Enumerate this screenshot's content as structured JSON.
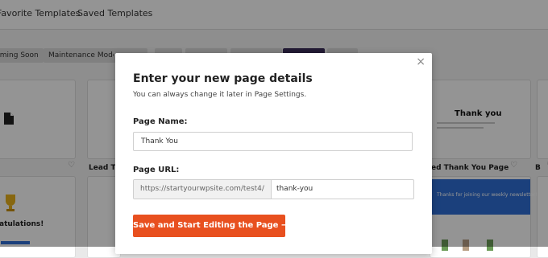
{
  "topbar": {
    "tabs": [
      "Favorite Templates",
      "Saved Templates"
    ]
  },
  "filters": {
    "chips": [
      "Coming Soon",
      "Maintenance Mode"
    ],
    "active_color": "#3b2e5a"
  },
  "background_cards": {
    "lead_caption": "Lead Tha",
    "thank_you_caption": "ed Thank You Page",
    "extra_caption": "B",
    "thank_you_heading": "Thank you",
    "newsletter_text": "Thanks for joining our weekly newsletter!",
    "congrats_text": "atulations!"
  },
  "modal": {
    "title": "Enter your new page details",
    "subtitle": "You can always change it later in Page Settings.",
    "page_name_label": "Page Name:",
    "page_name_value": "Thank You",
    "page_url_label": "Page URL:",
    "url_prefix": "https://startyourwpsite.com/test4/",
    "url_slug": "thank-you",
    "submit_label": "Save and Start Editing the Page  →",
    "close_glyph": "×"
  },
  "colors": {
    "accent": "#e8501f",
    "overlay": "rgba(0,0,0,0.42)"
  }
}
